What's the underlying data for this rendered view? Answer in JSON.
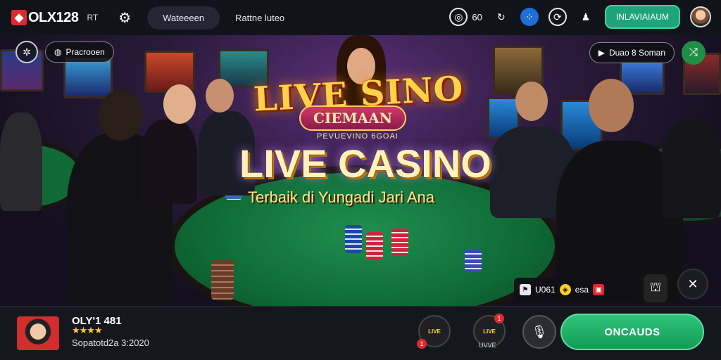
{
  "header": {
    "logo_text": "OLX128",
    "logo_sub": "RT",
    "nav_pill": "Wateeeen",
    "nav_link": "Rattne luteo",
    "coins_label": "60",
    "cta": "INLAVIAIAUM"
  },
  "hero": {
    "left_pill": "Pracrooen",
    "right_pill": "Duao 8 Soman",
    "title_top": "LIVE SINO",
    "ribbon": "CIEMAAN",
    "subribbon": "PEVUEVINO 6GOAI",
    "title_main": "LIVE CASINO",
    "tagline": "Terbaik di Yungadi Jari Ana",
    "mini_bar": {
      "left_text": "U061",
      "right_text": "esa"
    }
  },
  "bottom": {
    "user_name": "OLY'1 481",
    "stars": "★★★★",
    "user_meta": "Sopatotd2a 3:2020",
    "game1_label": "LIVE",
    "game2_label": "LIVE",
    "game2_caption": "UVVE",
    "badge_text": "1",
    "cta": "ONCAUDS"
  },
  "colors": {
    "accent_green": "#1fa37a",
    "cta_green": "#2fc47a",
    "brand_red": "#e0292c",
    "gold": "#ffd24a"
  }
}
